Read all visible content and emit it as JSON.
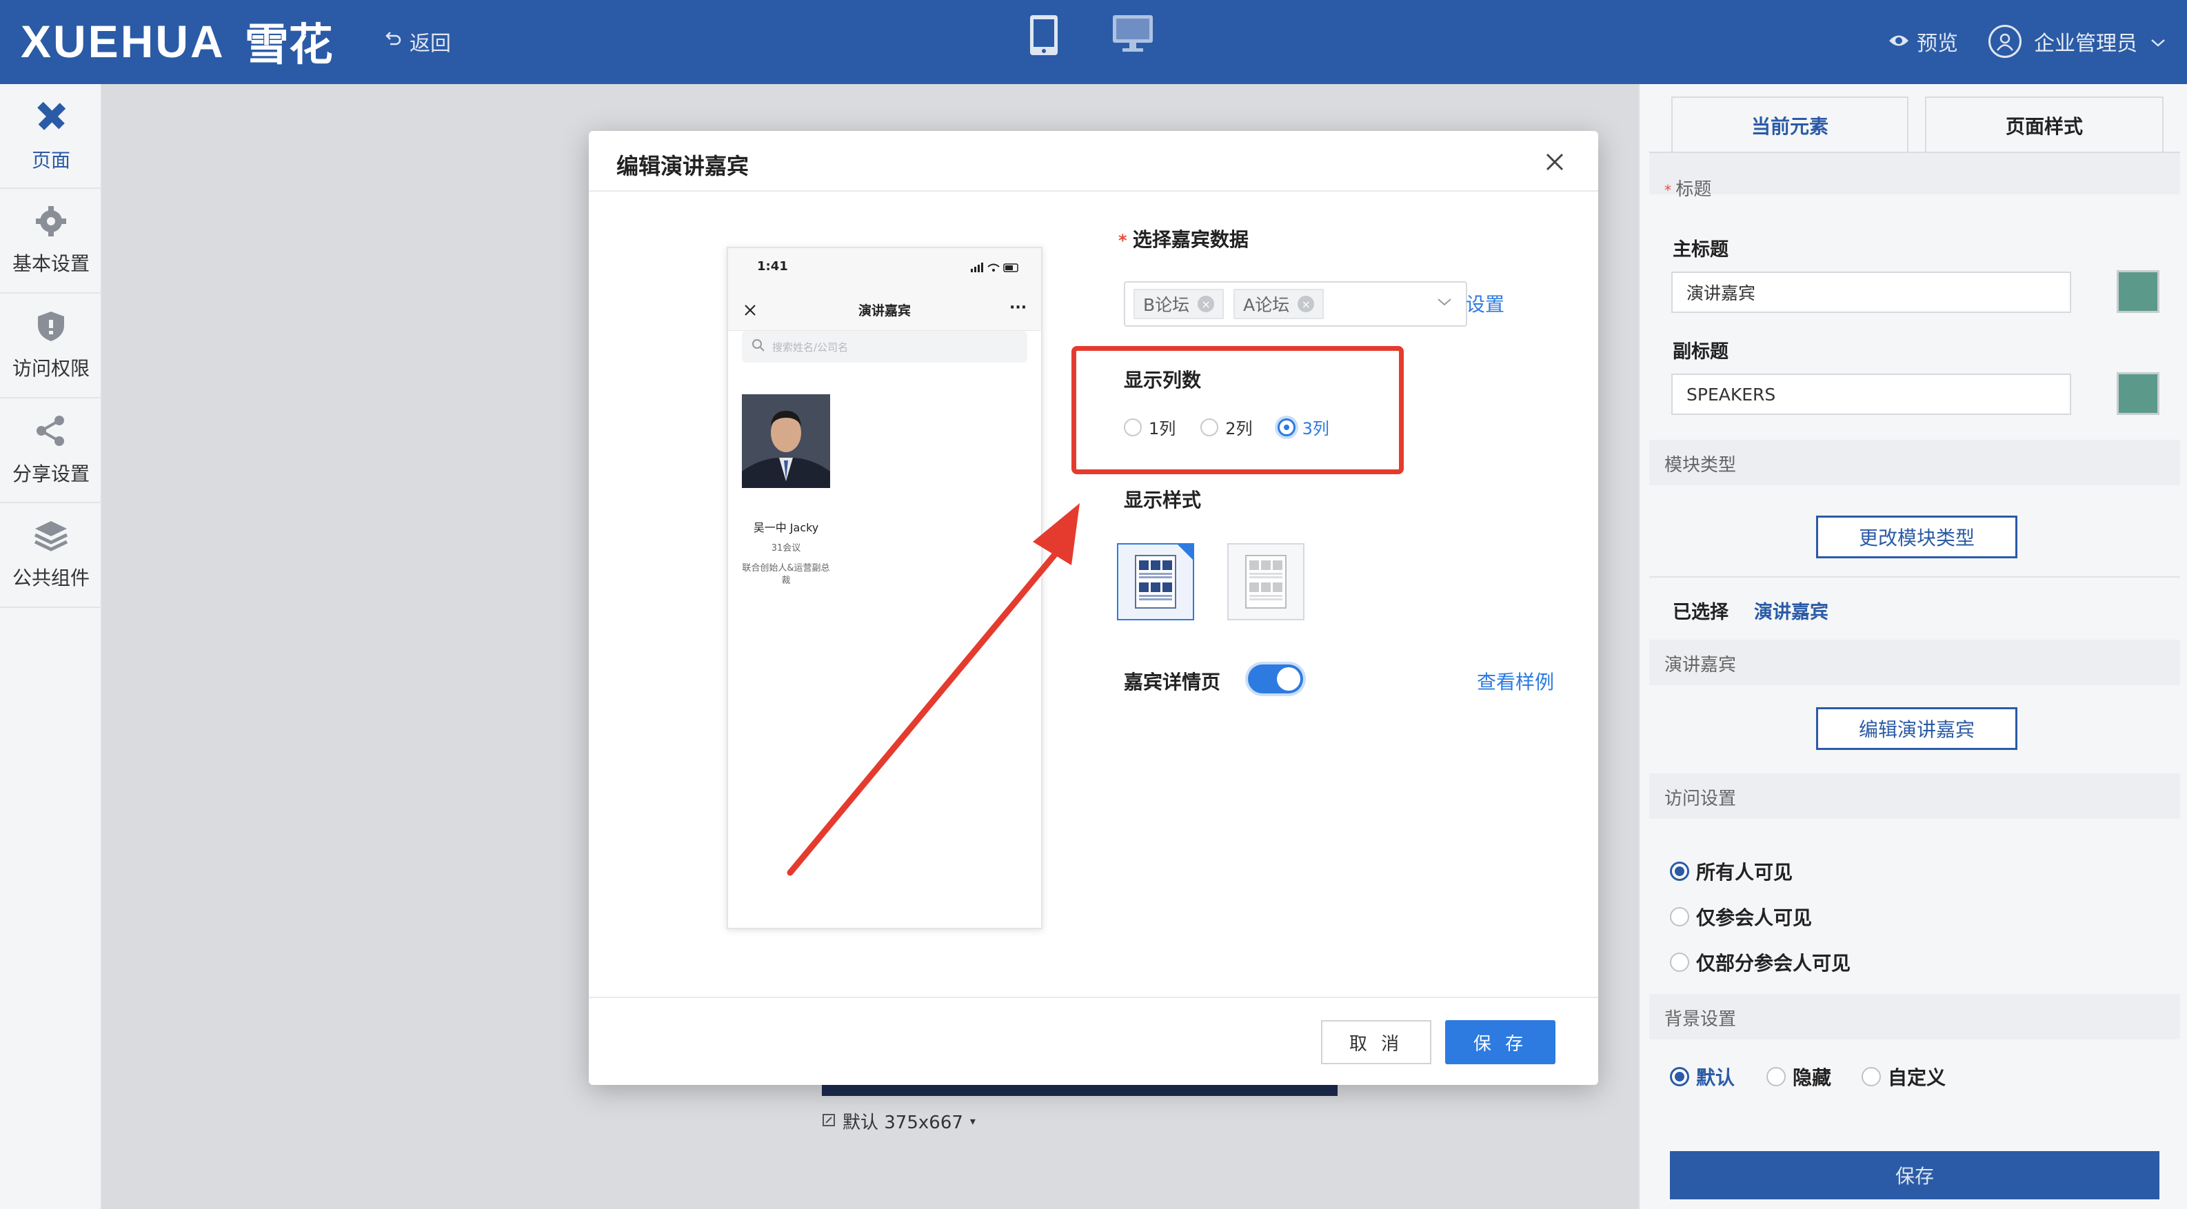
{
  "header": {
    "logo_text": "XUEHUA",
    "logo_cn": "雪花",
    "back_label": "返回",
    "preview_label": "预览",
    "user_label": "企业管理员"
  },
  "sidebar": {
    "items": [
      {
        "label": "页面",
        "icon": "pencil-ruler-icon",
        "active": true
      },
      {
        "label": "基本设置",
        "icon": "gear-icon"
      },
      {
        "label": "访问权限",
        "icon": "shield-icon"
      },
      {
        "label": "分享设置",
        "icon": "share-icon"
      },
      {
        "label": "公共组件",
        "icon": "layers-icon"
      }
    ]
  },
  "canvas": {
    "size_label": "默认 375x667"
  },
  "modal": {
    "title": "编辑演讲嘉宾",
    "phone": {
      "time": "1:41",
      "title": "演讲嘉宾",
      "search_placeholder": "搜索姓名/公司名",
      "speaker_name": "吴一中 Jacky",
      "speaker_org": "31会议",
      "speaker_title": "联合创始人&运营副总裁"
    },
    "select_label": "选择嘉宾数据",
    "tags": [
      "B论坛",
      "A论坛"
    ],
    "settings_link": "设置",
    "columns_label": "显示列数",
    "column_options": [
      "1列",
      "2列",
      "3列"
    ],
    "column_selected": "3列",
    "style_label": "显示样式",
    "detail_label": "嘉宾详情页",
    "detail_enabled": true,
    "sample_link": "查看样例",
    "cancel_label": "取 消",
    "save_label": "保 存"
  },
  "right_panel": {
    "tabs": [
      "当前元素",
      "页面样式"
    ],
    "active_tab": "当前元素",
    "title_section": "标题",
    "main_title_label": "主标题",
    "main_title_value": "演讲嘉宾",
    "sub_title_label": "副标题",
    "sub_title_value": "SPEAKERS",
    "module_type_label": "模块类型",
    "change_module_button": "更改模块类型",
    "selected_label": "已选择",
    "selected_value": "演讲嘉宾",
    "speakers_label": "演讲嘉宾",
    "edit_speakers_button": "编辑演讲嘉宾",
    "access_label": "访问设置",
    "access_options": [
      "所有人可见",
      "仅参会人可见",
      "仅部分参会人可见"
    ],
    "access_selected": "所有人可见",
    "background_label": "背景设置",
    "background_options": [
      "默认",
      "隐藏",
      "自定义"
    ],
    "background_selected": "默认",
    "save_button": "保存"
  },
  "colors": {
    "brand": "#2b5ba6",
    "accent": "#2d7be0",
    "highlight": "#e53b2f",
    "swatch": "#5b9a8b"
  }
}
